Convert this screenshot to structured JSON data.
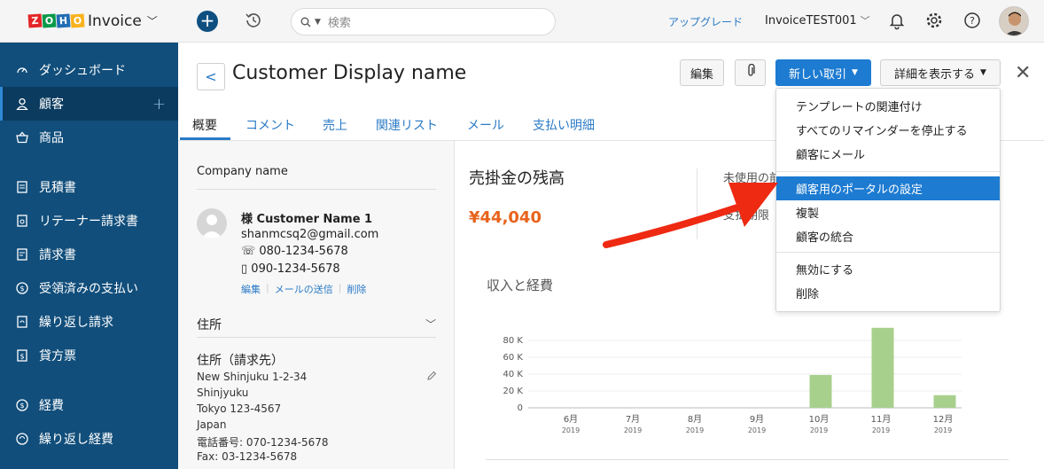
{
  "app": {
    "brand_logo_letters": [
      "Z",
      "O",
      "H",
      "O"
    ],
    "brand_logo_colors": [
      "#e42527",
      "#089949",
      "#226db4",
      "#f9b21d"
    ],
    "brand_name": "Invoice"
  },
  "sidebar": {
    "items": [
      {
        "label": "ダッシュボード",
        "icon": "dashboard-icon"
      },
      {
        "label": "顧客",
        "icon": "customer-icon",
        "active": true
      },
      {
        "label": "商品",
        "icon": "basket-icon"
      },
      {
        "label": "見積書",
        "icon": "estimate-icon"
      },
      {
        "label": "リテーナー請求書",
        "icon": "retainer-icon"
      },
      {
        "label": "請求書",
        "icon": "invoice-icon"
      },
      {
        "label": "受領済みの支払い",
        "icon": "payment-icon"
      },
      {
        "label": "繰り返し請求",
        "icon": "recurring-icon"
      },
      {
        "label": "貸方票",
        "icon": "credit-note-icon"
      },
      {
        "label": "経費",
        "icon": "expense-icon"
      },
      {
        "label": "繰り返し経費",
        "icon": "recurring-expense-icon"
      }
    ],
    "add_label": "+"
  },
  "topbar": {
    "search_placeholder": "検索",
    "upgrade_label": "アップグレード",
    "org_name": "InvoiceTEST001"
  },
  "header": {
    "title": "Customer Display name",
    "edit_label": "編集",
    "new_transaction_label": "新しい取引",
    "more_details_label": "詳細を表示する"
  },
  "tabs": [
    "概要",
    "コメント",
    "売上",
    "関連リスト",
    "メール",
    "支払い明細"
  ],
  "details": {
    "company_label": "Company name",
    "contact_name": "様 Customer Name 1",
    "email": "shanmcsq2@gmail.com",
    "phone": "080-1234-5678",
    "mobile": "090-1234-5678",
    "actions": [
      "編集",
      "メールの送信",
      "削除"
    ],
    "address_header": "住所",
    "billing_title": "住所（請求先）",
    "address_lines": [
      "New Shinjuku 1-2-34",
      "Shinjyuku",
      "Tokyo 123-4567",
      "Japan",
      "電話番号: 070-1234-5678",
      "Fax: 03-1234-5678"
    ]
  },
  "overview": {
    "receivables_title": "売掛金の残高",
    "receivables_amount": "¥44,040",
    "unused_label": "未使用の前",
    "unused_label2": "支払期限"
  },
  "chart_data": {
    "type": "bar",
    "title": "収入と経費",
    "categories": [
      "6月",
      "7月",
      "8月",
      "9月",
      "10月",
      "11月",
      "12月"
    ],
    "category_years": [
      "2019",
      "2019",
      "2019",
      "2019",
      "2019",
      "2019",
      "2019"
    ],
    "values": [
      0,
      0,
      0,
      0,
      39000,
      95000,
      15000
    ],
    "y_ticks": [
      "80 K",
      "60 K",
      "40 K",
      "20 K",
      "0"
    ],
    "ylim": [
      0,
      100000
    ],
    "bar_color": "#a8d08d"
  },
  "dropdown": {
    "groups": [
      [
        "テンプレートの関連付け",
        "すべてのリマインダーを停止する",
        "顧客にメール"
      ],
      [
        "顧客用のポータルの設定",
        "複製",
        "顧客の統合"
      ],
      [
        "無効にする",
        "削除"
      ]
    ],
    "highlighted": "顧客用のポータルの設定"
  },
  "annotation": {
    "arrow_color": "#ee2a12"
  }
}
